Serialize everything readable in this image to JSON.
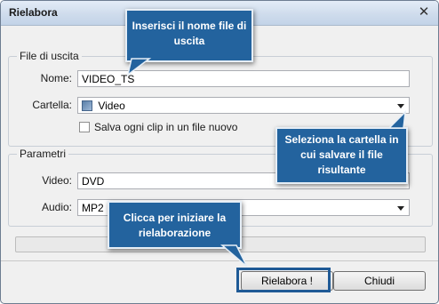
{
  "window": {
    "title": "Rielabora"
  },
  "output_group": {
    "title": "File di uscita",
    "name_label": "Nome:",
    "name_value": "VIDEO_TS",
    "folder_label": "Cartella:",
    "folder_value": "Video",
    "checkbox_label": "Salva ogni clip in un file nuovo"
  },
  "params_group": {
    "title": "Parametri",
    "video_label": "Video:",
    "video_value": "DVD",
    "audio_label": "Audio:",
    "audio_value": "MP2"
  },
  "buttons": {
    "primary": "Rielabora !",
    "close": "Chiudi"
  },
  "callouts": {
    "name": "Inserisci il nome file di uscita",
    "folder": "Seleziona la cartella in cui salvare il file risultante",
    "start": "Clicca per iniziare la rielaborazione"
  },
  "colors": {
    "callout_bg": "#23639e",
    "highlight_border": "#1f5a96"
  }
}
